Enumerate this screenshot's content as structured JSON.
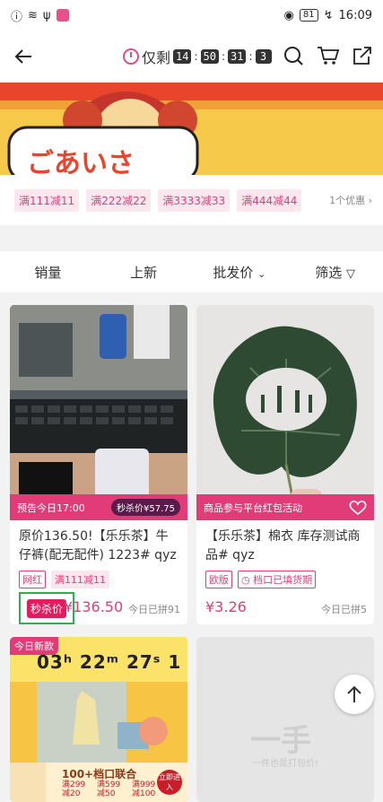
{
  "status_bar": {
    "battery": "81",
    "time": "16:09"
  },
  "header": {
    "countdown_label": "仅剩",
    "timer": [
      "14",
      "50",
      "31",
      "3"
    ]
  },
  "coupons": [
    "满111减11",
    "满222减22",
    "满3333减33",
    "满444减44"
  ],
  "offer_count": "1个优惠",
  "sort_bar": {
    "sales": "销量",
    "new": "上新",
    "wholesale": "批发价",
    "filter": "筛选"
  },
  "products": [
    {
      "ribbon_left": "预告今日17:00",
      "ribbon_right": "秒杀价¥57.75",
      "title": "原价136.50!【乐乐茶】牛仔裤(配无配件) 1223# qyz",
      "tags": [
        "网红",
        "满111减11"
      ],
      "badge": "秒杀价",
      "price": "¥136.50",
      "sold": "今日已拼91"
    },
    {
      "ribbon_left": "商品参与平台红包活动",
      "title": "【乐乐茶】棉衣 库存测试商品# qyz",
      "tags": [
        "欧版",
        "档口已填货期"
      ],
      "price": "¥3.26",
      "sold": "今日已拼5"
    },
    {
      "badge_new": "今日新款",
      "promo_time": "03ʰ 22ᵐ 27ˢ 1",
      "promo_text": "100+档口联合",
      "promo_deals": [
        "满299 减20",
        "满599 减50",
        "满999 减100"
      ],
      "promo_enter": "立即进入"
    },
    {
      "placeholder": "一手",
      "placeholder_sub": "一件也是打包价!"
    }
  ],
  "colors": {
    "accent": "#e23c78",
    "highlight_box": "#2bb24c"
  }
}
